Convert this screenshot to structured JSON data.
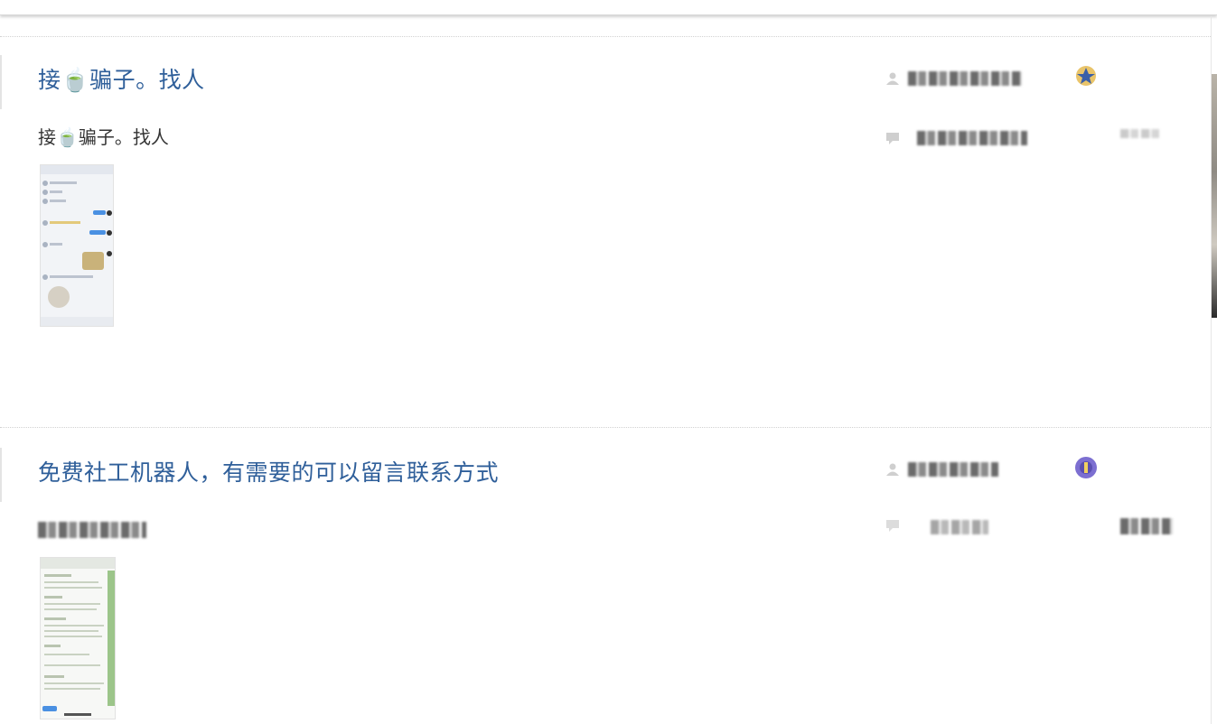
{
  "posts": [
    {
      "title": "接🍵骗子。找人",
      "excerpt": "接🍵骗子。找人",
      "thumbnail_icon": "chat-screenshot-thumbnail-icon",
      "author_icon": "user-icon",
      "reply_icon": "comment-icon",
      "badge_icon": "blue-star-badge-icon",
      "badge_color": "#3a5fa8"
    },
    {
      "title": "免费社工机器人，有需要的可以留言联系方式",
      "excerpt": "",
      "thumbnail_icon": "chat-screenshot-thumbnail-icon",
      "author_icon": "user-icon",
      "reply_icon": "comment-icon",
      "badge_icon": "purple-globe-badge-icon",
      "badge_color": "#5a4fb0"
    }
  ],
  "colors": {
    "title_link": "#2f5f9a",
    "excerpt_text": "#333333",
    "divider": "#d2d2d2"
  }
}
